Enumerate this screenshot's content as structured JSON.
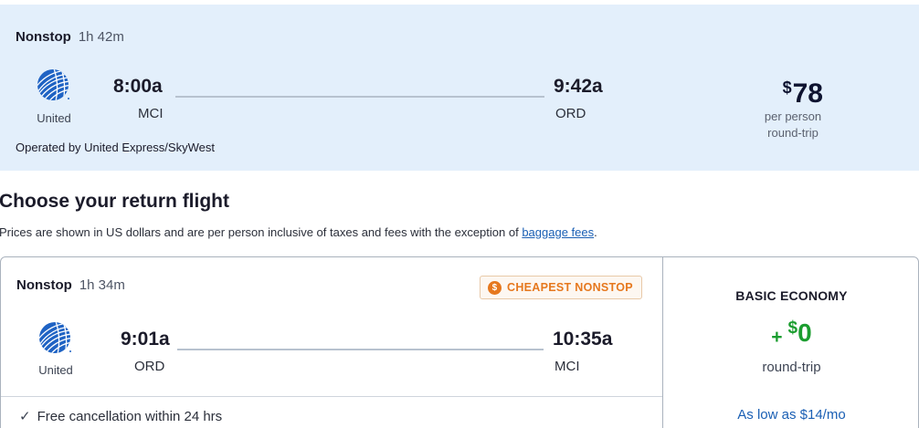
{
  "selected_flight": {
    "stops": "Nonstop",
    "duration": "1h 42m",
    "airline": "United",
    "depart_time": "8:00a",
    "depart_code": "MCI",
    "arrive_time": "9:42a",
    "arrive_code": "ORD",
    "operated_by": "Operated by United Express/SkyWest",
    "price_currency": "$",
    "price_amount": "78",
    "price_note_1": "per person",
    "price_note_2": "round-trip"
  },
  "return_section": {
    "heading": "Choose your return flight",
    "disclaimer": "Prices are shown in US dollars and are per person inclusive of taxes and fees with the exception of",
    "disclaimer_link": "baggage fees",
    "disclaimer_end": "."
  },
  "return_flight": {
    "stops": "Nonstop",
    "duration": "1h 34m",
    "badge": "CHEAPEST NONSTOP",
    "badge_icon": "$",
    "airline": "United",
    "depart_time": "9:01a",
    "depart_code": "ORD",
    "arrive_time": "10:35a",
    "arrive_code": "MCI",
    "fare_class": "BASIC ECONOMY",
    "fare_plus": "+",
    "fare_currency": "$",
    "fare_amount": "0",
    "fare_note": "round-trip",
    "financing_link": "As low as $14/mo",
    "free_cancellation": "Free cancellation within 24 hrs"
  },
  "colors": {
    "selected_bg": "#e3effb",
    "badge_orange": "#e6781e",
    "price_green": "#1b9d2f",
    "link_blue": "#1a5fb4"
  },
  "icons": [
    "united-globe-logo",
    "dollar-badge-icon",
    "check-icon"
  ]
}
